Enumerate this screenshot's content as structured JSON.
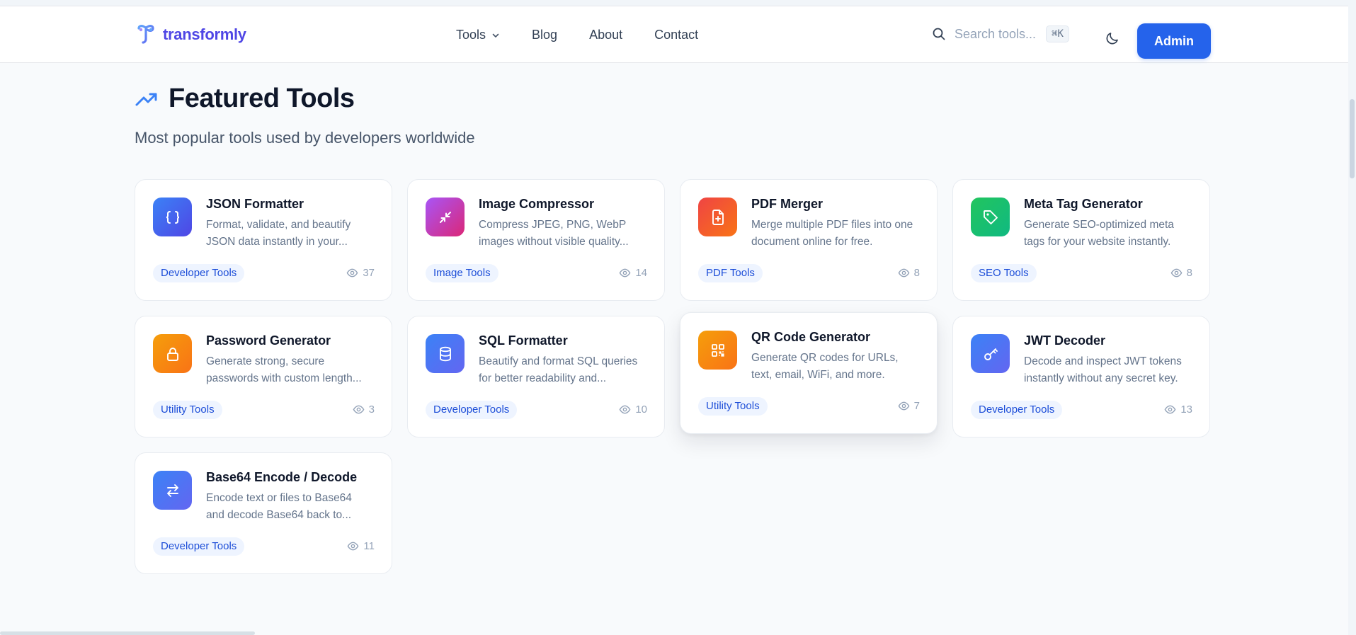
{
  "brand": {
    "name": "transformly",
    "accent": "#2563eb",
    "logo_color": "#4f46e5"
  },
  "nav": {
    "items": [
      {
        "label": "Tools",
        "has_dropdown": true
      },
      {
        "label": "Blog"
      },
      {
        "label": "About"
      },
      {
        "label": "Contact"
      }
    ]
  },
  "search": {
    "placeholder": "Search tools...",
    "shortcut": "⌘K",
    "icon": "search-icon"
  },
  "header_actions": {
    "theme_icon": "moon-icon",
    "admin_label": "Admin"
  },
  "section": {
    "icon": "trending-up-icon",
    "title": "Featured Tools",
    "subtitle": "Most popular tools used by developers worldwide"
  },
  "tools": [
    {
      "title": "JSON Formatter",
      "desc_line1": "Format, validate, and beautify",
      "desc_line2": "JSON data instantly in your...",
      "category": "Developer Tools",
      "views": "37",
      "icon": "braces-icon",
      "color": "#4f46e5"
    },
    {
      "title": "Image Compressor",
      "desc_line1": "Compress JPEG, PNG, WebP",
      "desc_line2": "images without visible quality...",
      "category": "Image Tools",
      "views": "14",
      "icon": "minimize-arrows-icon",
      "color": "#c026d3"
    },
    {
      "title": "PDF Merger",
      "desc_line1": "Merge multiple PDF files into one",
      "desc_line2": "document online for free.",
      "category": "PDF Tools",
      "views": "8",
      "icon": "file-plus-icon",
      "color": "#f0522a"
    },
    {
      "title": "Meta Tag Generator",
      "desc_line1": "Generate SEO-optimized meta",
      "desc_line2": "tags for your website instantly.",
      "category": "SEO Tools",
      "views": "8",
      "icon": "tag-icon",
      "color": "#16b878"
    },
    {
      "title": "Password Generator",
      "desc_line1": "Generate strong, secure",
      "desc_line2": "passwords with custom length...",
      "category": "Utility Tools",
      "views": "3",
      "icon": "lock-icon",
      "color": "#f59e0b"
    },
    {
      "title": "SQL Formatter",
      "desc_line1": "Beautify and format SQL queries",
      "desc_line2": "for better readability and...",
      "category": "Developer Tools",
      "views": "10",
      "icon": "database-icon",
      "color": "#4f46e5"
    },
    {
      "title": "QR Code Generator",
      "desc_line1": "Generate QR codes for URLs,",
      "desc_line2": "text, email, WiFi, and more.",
      "category": "Utility Tools",
      "views": "7",
      "icon": "qr-code-icon",
      "color": "#f59e0b"
    },
    {
      "title": "JWT Decoder",
      "desc_line1": "Decode and inspect JWT tokens",
      "desc_line2": "instantly without any secret key.",
      "category": "Developer Tools",
      "views": "13",
      "icon": "key-icon",
      "color": "#4f46e5"
    },
    {
      "title": "Base64 Encode / Decode",
      "desc_line1": "Encode text or files to Base64",
      "desc_line2": "and decode Base64 back to...",
      "category": "Developer Tools",
      "views": "11",
      "icon": "swap-arrows-icon",
      "color": "#4f46e5"
    }
  ]
}
